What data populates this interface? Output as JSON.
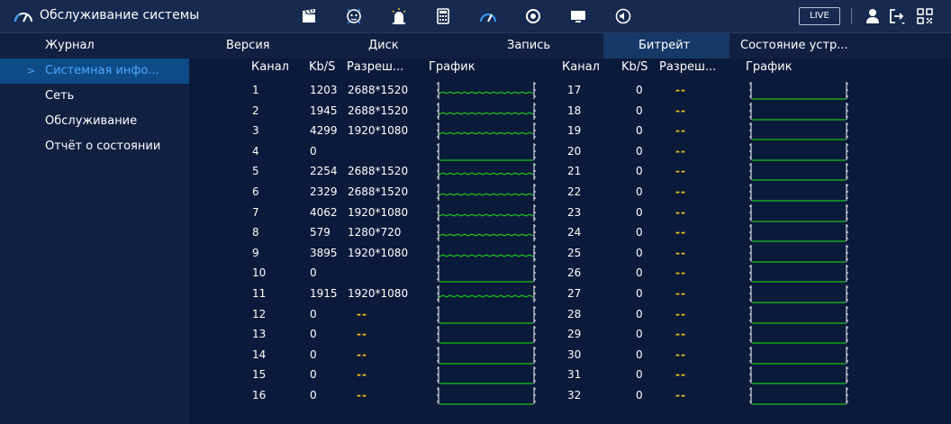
{
  "header": {
    "title": "Обслуживание системы",
    "icons": [
      "gauge-icon",
      "clapperboard-icon",
      "face-icon",
      "alarm-icon",
      "calculator-icon",
      "performance-icon",
      "sync-icon",
      "monitor-icon",
      "speaker-icon"
    ],
    "live_label": "LIVE",
    "right_icons": [
      "user-icon",
      "logout-icon",
      "qr-icon"
    ]
  },
  "sidebar": {
    "items": [
      {
        "label": "Журнал",
        "active": false
      },
      {
        "label": "Системная инфо...",
        "active": true
      },
      {
        "label": "Сеть",
        "active": false
      },
      {
        "label": "Обслуживание",
        "active": false
      },
      {
        "label": "Отчёт о состоянии",
        "active": false
      }
    ]
  },
  "tabs": [
    {
      "label": "Версия",
      "active": false
    },
    {
      "label": "Диск",
      "active": false
    },
    {
      "label": "Запись",
      "active": false
    },
    {
      "label": "Битрейт",
      "active": true
    },
    {
      "label": "Состояние устр...",
      "active": false
    }
  ],
  "columns": {
    "left": [
      "Канал",
      "Kb/S",
      "Разреш...",
      "График"
    ],
    "right": [
      "Канал",
      "Kb/S",
      "Разреш...",
      "График"
    ]
  },
  "rows_left": [
    {
      "channel": "1",
      "kbs": "1203",
      "res": "2688*1520",
      "graph": "wave"
    },
    {
      "channel": "2",
      "kbs": "1945",
      "res": "2688*1520",
      "graph": "wave"
    },
    {
      "channel": "3",
      "kbs": "4299",
      "res": "1920*1080",
      "graph": "wave"
    },
    {
      "channel": "4",
      "kbs": "0",
      "res": "",
      "graph": "flat"
    },
    {
      "channel": "5",
      "kbs": "2254",
      "res": "2688*1520",
      "graph": "wave"
    },
    {
      "channel": "6",
      "kbs": "2329",
      "res": "2688*1520",
      "graph": "wave"
    },
    {
      "channel": "7",
      "kbs": "4062",
      "res": "1920*1080",
      "graph": "wave"
    },
    {
      "channel": "8",
      "kbs": "579",
      "res": "1280*720",
      "graph": "wave"
    },
    {
      "channel": "9",
      "kbs": "3895",
      "res": "1920*1080",
      "graph": "wave"
    },
    {
      "channel": "10",
      "kbs": "0",
      "res": "",
      "graph": "flat"
    },
    {
      "channel": "11",
      "kbs": "1915",
      "res": "1920*1080",
      "graph": "wave"
    },
    {
      "channel": "12",
      "kbs": "0",
      "res": "--",
      "graph": "flat"
    },
    {
      "channel": "13",
      "kbs": "0",
      "res": "--",
      "graph": "flat"
    },
    {
      "channel": "14",
      "kbs": "0",
      "res": "--",
      "graph": "flat"
    },
    {
      "channel": "15",
      "kbs": "0",
      "res": "--",
      "graph": "flat"
    },
    {
      "channel": "16",
      "kbs": "0",
      "res": "--",
      "graph": "flat"
    }
  ],
  "rows_right": [
    {
      "channel": "17",
      "kbs": "0",
      "res": "--",
      "graph": "flat"
    },
    {
      "channel": "18",
      "kbs": "0",
      "res": "--",
      "graph": "flat"
    },
    {
      "channel": "19",
      "kbs": "0",
      "res": "--",
      "graph": "flat"
    },
    {
      "channel": "20",
      "kbs": "0",
      "res": "--",
      "graph": "flat"
    },
    {
      "channel": "21",
      "kbs": "0",
      "res": "--",
      "graph": "flat"
    },
    {
      "channel": "22",
      "kbs": "0",
      "res": "--",
      "graph": "flat"
    },
    {
      "channel": "23",
      "kbs": "0",
      "res": "--",
      "graph": "flat"
    },
    {
      "channel": "24",
      "kbs": "0",
      "res": "--",
      "graph": "flat"
    },
    {
      "channel": "25",
      "kbs": "0",
      "res": "--",
      "graph": "flat"
    },
    {
      "channel": "26",
      "kbs": "0",
      "res": "--",
      "graph": "flat"
    },
    {
      "channel": "27",
      "kbs": "0",
      "res": "--",
      "graph": "flat"
    },
    {
      "channel": "28",
      "kbs": "0",
      "res": "--",
      "graph": "flat"
    },
    {
      "channel": "29",
      "kbs": "0",
      "res": "--",
      "graph": "flat"
    },
    {
      "channel": "30",
      "kbs": "0",
      "res": "--",
      "graph": "flat"
    },
    {
      "channel": "31",
      "kbs": "0",
      "res": "--",
      "graph": "flat"
    },
    {
      "channel": "32",
      "kbs": "0",
      "res": "--",
      "graph": "flat"
    }
  ],
  "colors": {
    "background": "#0a1a3a",
    "accent": "#4aa8ff",
    "graph_line": "#19c21c",
    "dash": "#f4c31c"
  }
}
